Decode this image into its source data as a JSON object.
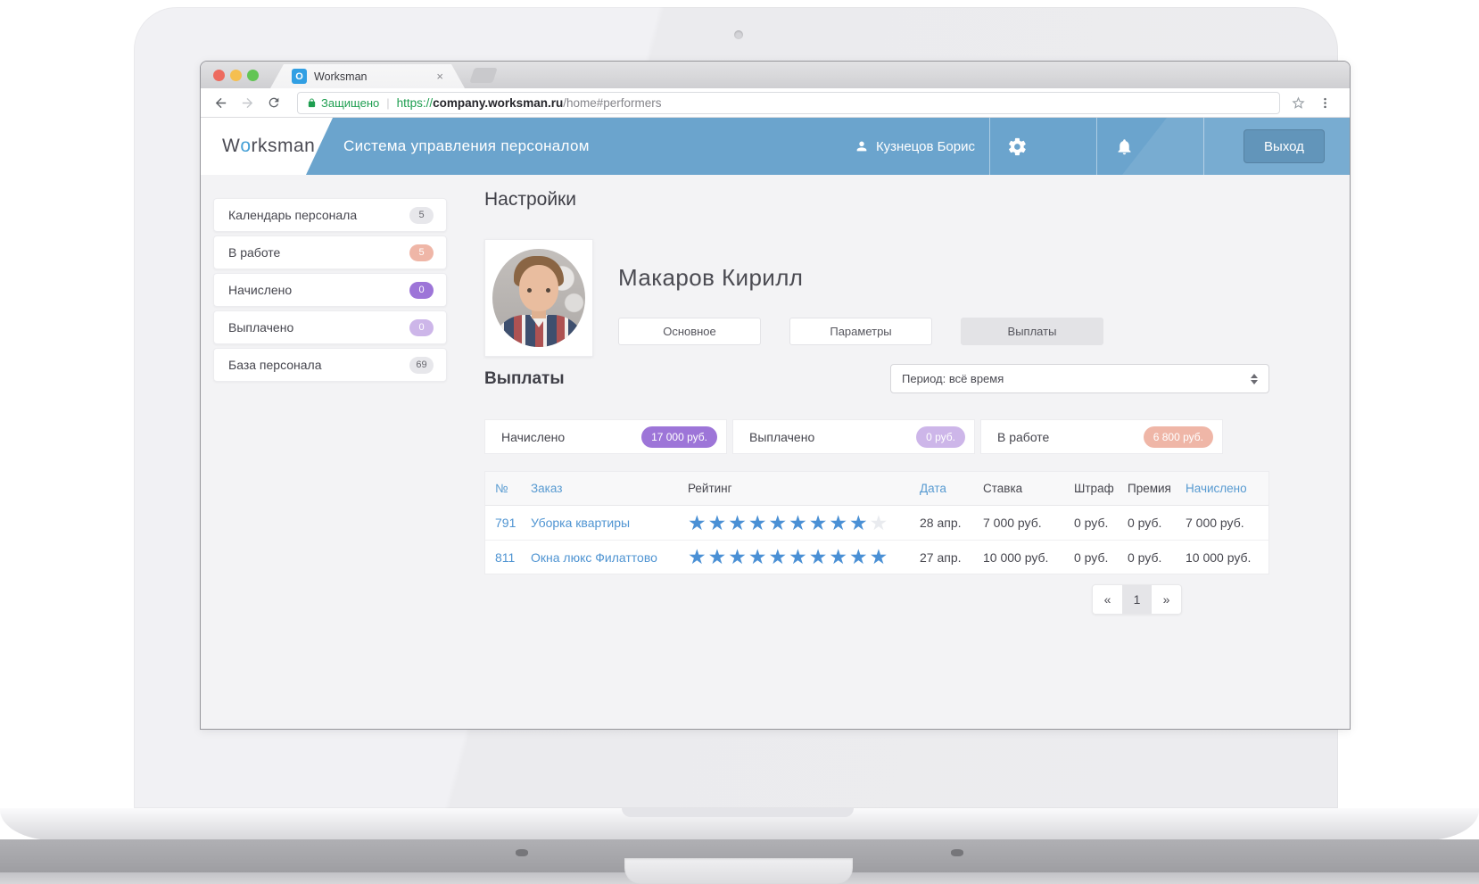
{
  "browser": {
    "tab": {
      "title": "Worksman",
      "favicon_letter": "O",
      "close": "×"
    },
    "address_bar": {
      "security_label": "Защищено",
      "url_scheme": "https://",
      "url_host": "company.worksman.ru",
      "url_path": "/home#performers"
    }
  },
  "app_header": {
    "logo_prefix": "W",
    "logo_accent": "o",
    "logo_suffix": "rksman",
    "app_title": "Система управления персоналом",
    "user_name": "Кузнецов Борис",
    "logout_label": "Выход"
  },
  "sidebar": {
    "items": [
      {
        "label": "Календарь персонала",
        "badge": "5",
        "badge_bg": "#e7e7eb",
        "badge_fg": "#68686f"
      },
      {
        "label": "В работе",
        "badge": "5",
        "badge_bg": "#efb6a7",
        "badge_fg": "#ffffff"
      },
      {
        "label": "Начислено",
        "badge": "0",
        "badge_bg": "#9d75d8",
        "badge_fg": "#ffffff"
      },
      {
        "label": "Выплачено",
        "badge": "0",
        "badge_bg": "#cdb6e9",
        "badge_fg": "#ffffff"
      },
      {
        "label": "База персонала",
        "badge": "69",
        "badge_bg": "#e7e7eb",
        "badge_fg": "#68686f"
      }
    ]
  },
  "main": {
    "page_title": "Настройки",
    "profile": {
      "name": "Макаров Кирилл"
    },
    "tabs": [
      {
        "label": "Основное",
        "active": false
      },
      {
        "label": "Параметры",
        "active": false
      },
      {
        "label": "Выплаты",
        "active": true
      }
    ],
    "payments": {
      "section_title": "Выплаты",
      "period_value": "Период: всё время",
      "summary": [
        {
          "label": "Начислено",
          "value": "17 000 руб.",
          "bg": "#9d75d8"
        },
        {
          "label": "Выплачено",
          "value": "0 руб.",
          "bg": "#cdb6e9"
        },
        {
          "label": "В работе",
          "value": "6 800 руб.",
          "bg": "#efb6a7"
        }
      ],
      "table": {
        "headers": [
          "№",
          "Заказ",
          "Рейтинг",
          "Дата",
          "Ставка",
          "Штраф",
          "Премия",
          "Начислено"
        ],
        "rows": [
          {
            "num": "791",
            "order": "Уборка квартиры",
            "rating": 9,
            "rating_max": 10,
            "date": "28 апр.",
            "rate": "7 000 руб.",
            "fine": "0 руб.",
            "bonus": "0 руб.",
            "accrued": "7 000 руб."
          },
          {
            "num": "811",
            "order": "Окна люкс Филаттово",
            "rating": 10,
            "rating_max": 10,
            "date": "27 апр.",
            "rate": "10 000 руб.",
            "fine": "0 руб.",
            "bonus": "0 руб.",
            "accrued": "10 000 руб."
          }
        ]
      },
      "pagination": {
        "prev": "«",
        "page": "1",
        "next": "»"
      }
    }
  },
  "colors": {
    "header_blue": "#6ba4cd",
    "link_blue": "#4f94d2",
    "star_blue": "#4a90d5"
  }
}
